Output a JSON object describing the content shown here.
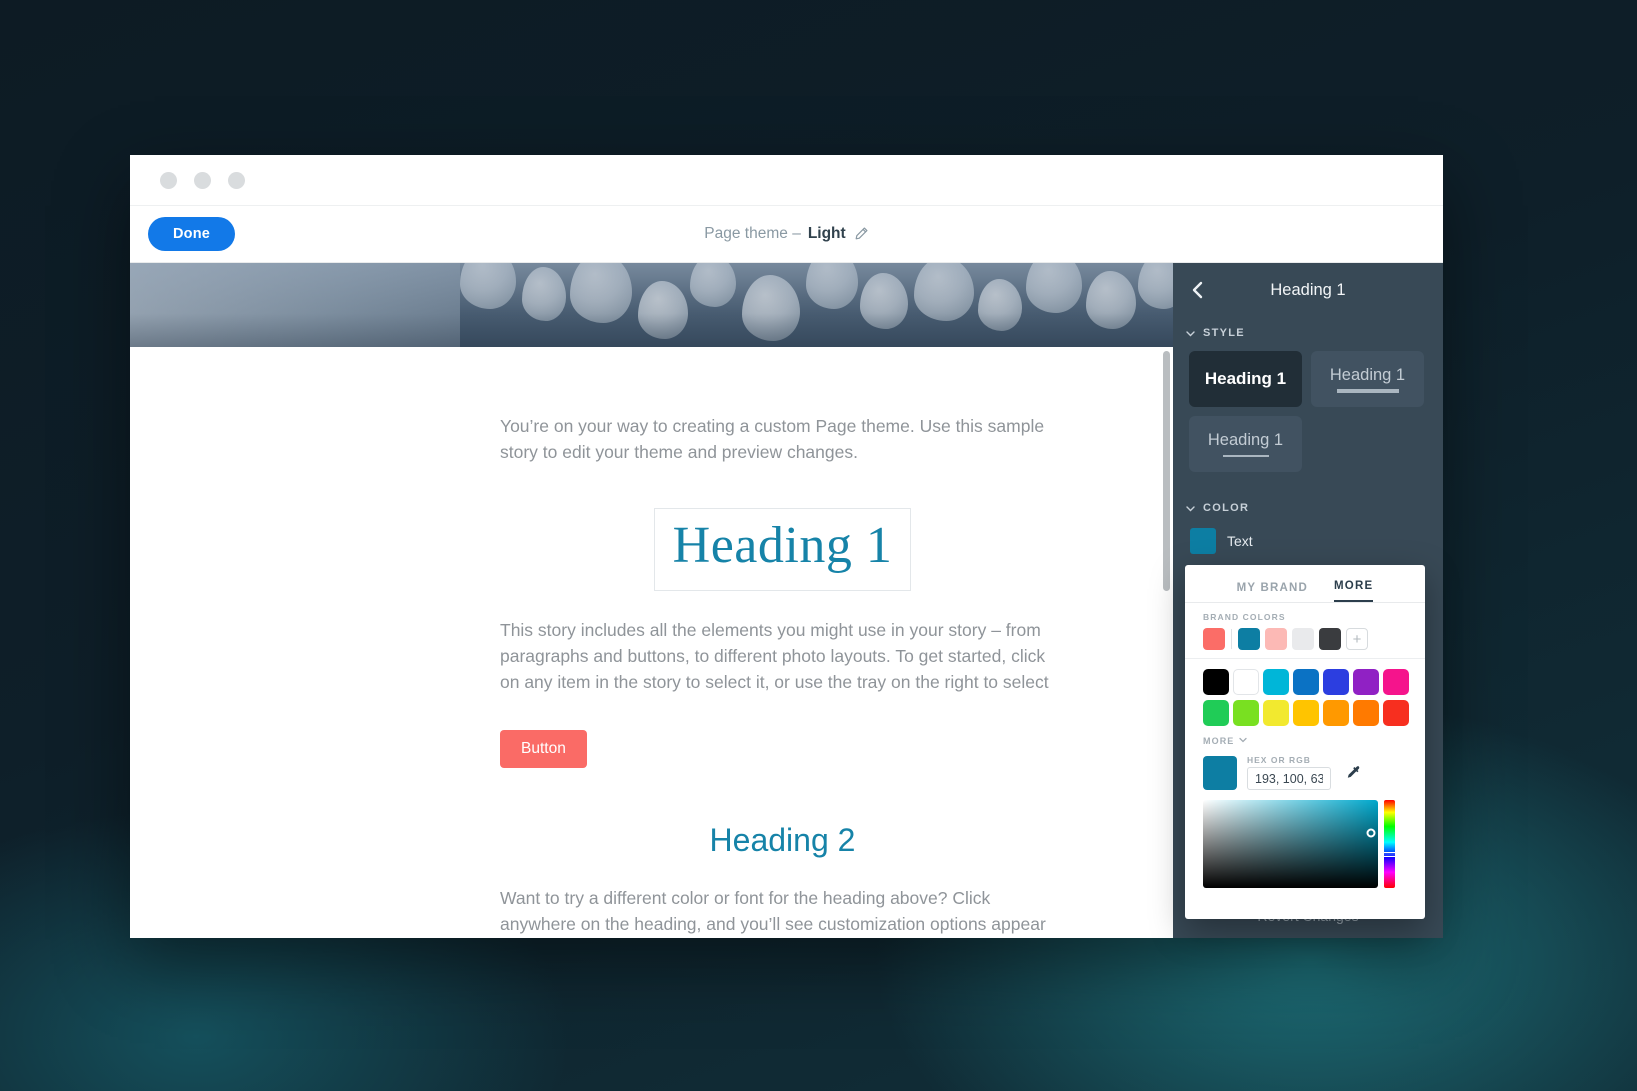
{
  "window": {
    "traffic_lights": [
      "close",
      "minimize",
      "maximize"
    ],
    "toolbar": {
      "done_label": "Done",
      "theme_prefix": "Page theme –",
      "theme_value": "Light",
      "edit_icon": "pencil-icon"
    }
  },
  "canvas": {
    "paragraph_1": "You’re on your way to creating a custom Page theme. Use this sample story to edit your theme and preview changes.",
    "heading_1": "Heading 1",
    "paragraph_2": "This story includes all the elements you might use in your story – from paragraphs and buttons, to different photo layouts. To get started, click on any item in the story to select it, or use the tray on the right to select",
    "button_label": "Button",
    "heading_2": "Heading 2",
    "paragraph_3": "Want to try a different color or font for the heading above? Click anywhere on the heading, and you’ll see customization options appear on the right.",
    "heading_color": "#1683a8",
    "button_color": "#fa6b66",
    "body_text_color": "#8f9499"
  },
  "tray": {
    "back_icon": "chevron-left-icon",
    "title": "Heading 1",
    "style_section": {
      "label": "STYLE",
      "collapse_icon": "chevron-down-icon",
      "options": [
        {
          "label": "Heading 1",
          "variant": "bold",
          "selected": true
        },
        {
          "label": "Heading 1",
          "variant": "double-underline",
          "selected": false
        },
        {
          "label": "Heading 1",
          "variant": "single-underline",
          "selected": false
        }
      ]
    },
    "color_section": {
      "label": "COLOR",
      "collapse_icon": "chevron-down-icon",
      "rows": [
        {
          "name": "Text",
          "color": "#0d7ea3"
        }
      ]
    },
    "revert_label": "Revert Changes",
    "panel_bg": "#384956"
  },
  "color_popover": {
    "tabs": [
      {
        "label": "MY BRAND",
        "active": false
      },
      {
        "label": "MORE",
        "active": true
      }
    ],
    "brand_colors_label": "BRAND COLORS",
    "brand_colors": [
      "#fb6d67",
      "#0d7ea3",
      "#fcb9b5",
      "#e9eaec",
      "#3a3c3f"
    ],
    "add_brand_color_icon": "plus-icon",
    "swatches": [
      "#000000",
      "#ffffff",
      "#00b6d8",
      "#0b72c4",
      "#2c3ee0",
      "#9021c4",
      "#f5148c",
      "#20cc57",
      "#79e021",
      "#f2e92f",
      "#ffc400",
      "#ff9900",
      "#ff7a00",
      "#f72f1f"
    ],
    "more_label": "MORE",
    "more_icon": "chevron-down-icon",
    "hex_label": "HEX OR RGB",
    "hex_value": "193, 100, 63",
    "current_color": "#0d7ea3",
    "eyedropper_icon": "eyedropper-icon"
  }
}
